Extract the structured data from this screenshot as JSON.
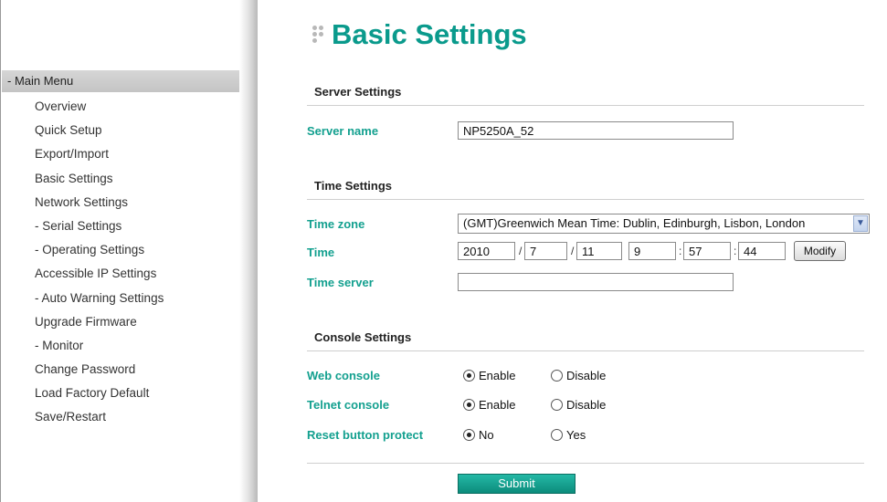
{
  "sidebar": {
    "header": "- Main Menu",
    "items": [
      "Overview",
      "Quick Setup",
      "Export/Import",
      "Basic Settings",
      "Network Settings",
      "- Serial Settings",
      "- Operating Settings",
      "Accessible IP Settings",
      "- Auto Warning Settings",
      "Upgrade Firmware",
      "- Monitor",
      "Change Password",
      "Load Factory Default",
      "Save/Restart"
    ]
  },
  "page": {
    "title": "Basic Settings",
    "accent_color": "#0a9a8c"
  },
  "server_settings": {
    "section_title": "Server Settings",
    "server_name_label": "Server name",
    "server_name_value": "NP5250A_52"
  },
  "time_settings": {
    "section_title": "Time Settings",
    "time_zone_label": "Time zone",
    "time_zone_value": "(GMT)Greenwich Mean Time: Dublin, Edinburgh, Lisbon, London",
    "time_label": "Time",
    "year": "2010",
    "month": "7",
    "day": "11",
    "hour": "9",
    "minute": "57",
    "second": "44",
    "date_sep": "/",
    "time_sep": ":",
    "modify_label": "Modify",
    "time_server_label": "Time server",
    "time_server_value": ""
  },
  "console_settings": {
    "section_title": "Console Settings",
    "web_console_label": "Web console",
    "telnet_console_label": "Telnet console",
    "reset_button_label": "Reset button protect",
    "enable_label": "Enable",
    "disable_label": "Disable",
    "no_label": "No",
    "yes_label": "Yes",
    "web_console_selected": "Enable",
    "telnet_console_selected": "Enable",
    "reset_button_selected": "No"
  },
  "submit_label": "Submit"
}
